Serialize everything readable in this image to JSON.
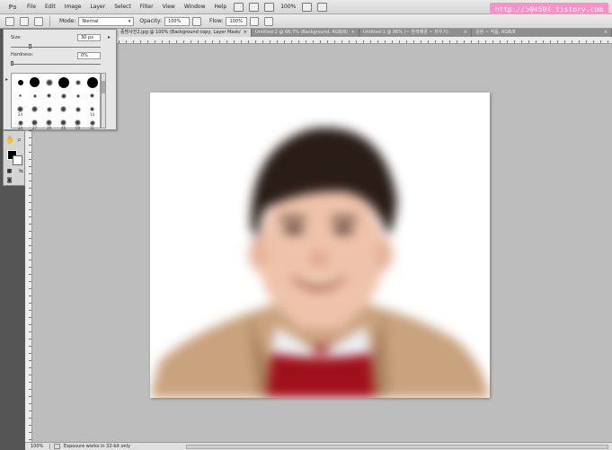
{
  "app": {
    "logo": "Ps"
  },
  "menu": [
    "File",
    "Edit",
    "Image",
    "Layer",
    "Select",
    "Filter",
    "View",
    "Window",
    "Help"
  ],
  "menubar": {
    "zoom": "100%"
  },
  "watermark": "http://504504.tistory.com",
  "options": {
    "mode_label": "Mode:",
    "mode_value": "Normal",
    "opacity_label": "Opacity:",
    "opacity_value": "100%",
    "flow_label": "Flow:",
    "flow_value": "100%"
  },
  "tabs": [
    {
      "label": "증명사진2.jpg @ 100% (Background copy, Layer Mask/8)",
      "active": true
    },
    {
      "label": "Untitled-2 @ 66.7% (Background, RGB/8)",
      "active": false
    },
    {
      "label": "Untitled-1 @ 86% (~ 흰색배경 ~ 자우기)",
      "active": false
    },
    {
      "label": "강원 ~ 작품, RGB/8",
      "active": false
    }
  ],
  "brush_panel": {
    "size_label": "Size:",
    "size_value": "30 px",
    "hardness_label": "Hardness:",
    "hardness_value": "0%",
    "size_level": 0.2,
    "hardness_level": 0.0,
    "presets": [
      {
        "size": 6,
        "soft": false,
        "num": ""
      },
      {
        "size": 11,
        "soft": false,
        "num": ""
      },
      {
        "size": 8,
        "soft": true,
        "num": ""
      },
      {
        "size": 12,
        "soft": false,
        "num": ""
      },
      {
        "size": 6,
        "soft": true,
        "num": ""
      },
      {
        "size": 12,
        "soft": false,
        "num": ""
      },
      {
        "size": 3,
        "soft": true,
        "num": ""
      },
      {
        "size": 4,
        "soft": true,
        "num": ""
      },
      {
        "size": 5,
        "soft": true,
        "num": ""
      },
      {
        "size": 6,
        "soft": true,
        "num": ""
      },
      {
        "size": 4,
        "soft": true,
        "num": ""
      },
      {
        "size": 5,
        "soft": true,
        "num": ""
      },
      {
        "size": 7,
        "soft": true,
        "num": "24"
      },
      {
        "size": 7,
        "soft": true,
        "num": ""
      },
      {
        "size": 6,
        "soft": true,
        "num": ""
      },
      {
        "size": 7,
        "soft": true,
        "num": ""
      },
      {
        "size": 6,
        "soft": true,
        "num": ""
      },
      {
        "size": 5,
        "soft": true,
        "num": "14"
      },
      {
        "size": 6,
        "soft": true,
        "num": "24"
      },
      {
        "size": 7,
        "soft": true,
        "num": "27"
      },
      {
        "size": 7,
        "soft": true,
        "num": "39"
      },
      {
        "size": 7,
        "soft": true,
        "num": "46"
      },
      {
        "size": 7,
        "soft": true,
        "num": "59"
      },
      {
        "size": 6,
        "soft": true,
        "num": "11"
      },
      {
        "size": 6,
        "soft": true,
        "num": "17"
      }
    ]
  },
  "colors": {
    "foreground": "#000000",
    "background": "#ffffff"
  },
  "status": {
    "zoom": "100%",
    "message": "Exposure works in 32-bit only"
  }
}
